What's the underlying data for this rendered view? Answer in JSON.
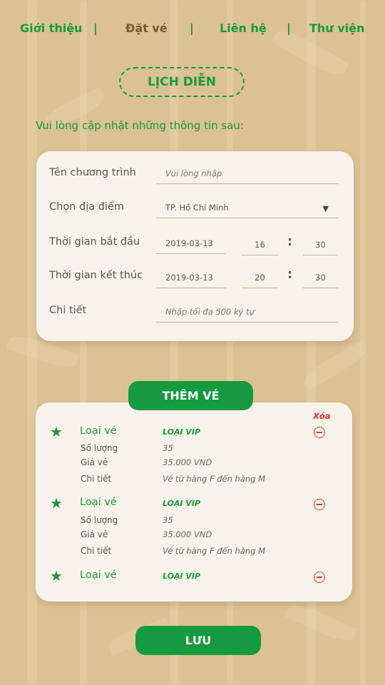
{
  "nav": {
    "items": [
      {
        "label": "Giới thiệu"
      },
      {
        "label": "Đặt vé"
      },
      {
        "label": "Liên hệ"
      },
      {
        "label": "Thư viện"
      }
    ],
    "separator": "|"
  },
  "page_title": "LỊCH DIỄN",
  "instruction": "Vui lòng cập nhật những thông tin sau:",
  "form": {
    "program_name": {
      "label": "Tên chương trình",
      "placeholder": "Vui lòng nhập"
    },
    "location": {
      "label": "Chọn địa điểm",
      "value": "TP. Hồ Chí Minh"
    },
    "start": {
      "label": "Thời gian bắt đầu",
      "date": "2019-03-13",
      "hour": "16",
      "minute": "30"
    },
    "end": {
      "label": "Thời gian kết thúc",
      "date": "2019-03-13",
      "hour": "20",
      "minute": "30"
    },
    "detail": {
      "label": "Chi tiết",
      "placeholder": "Nhập tối đa 500 ký tự"
    },
    "time_colon": ":"
  },
  "add_ticket_label": "THÊM VÉ",
  "tickets": {
    "delete_header": "Xóa",
    "items": [
      {
        "type_label": "Loại vé",
        "type_value": "LOẠI VIP",
        "qty_label": "Số lượng",
        "qty_value": "35",
        "price_label": "Giá vé",
        "price_value": "35.000 VND",
        "detail_label": "Chi tiết",
        "detail_value": "Vé từ hàng F đến hàng M"
      },
      {
        "type_label": "Loại vé",
        "type_value": "LOẠI VIP",
        "qty_label": "Số lượng",
        "qty_value": "35",
        "price_label": "Giá vé",
        "price_value": "35.000 VND",
        "detail_label": "Chi tiết",
        "detail_value": "Vé từ hàng F đến hàng M"
      },
      {
        "type_label": "Loại vé",
        "type_value": "LOẠI VIP"
      }
    ]
  },
  "save_label": "LƯU",
  "colors": {
    "accent": "#159a3f",
    "background": "#dcc193",
    "card": "#f8f3ea",
    "delete": "#d9342b",
    "active_nav": "#7a5a2e"
  }
}
